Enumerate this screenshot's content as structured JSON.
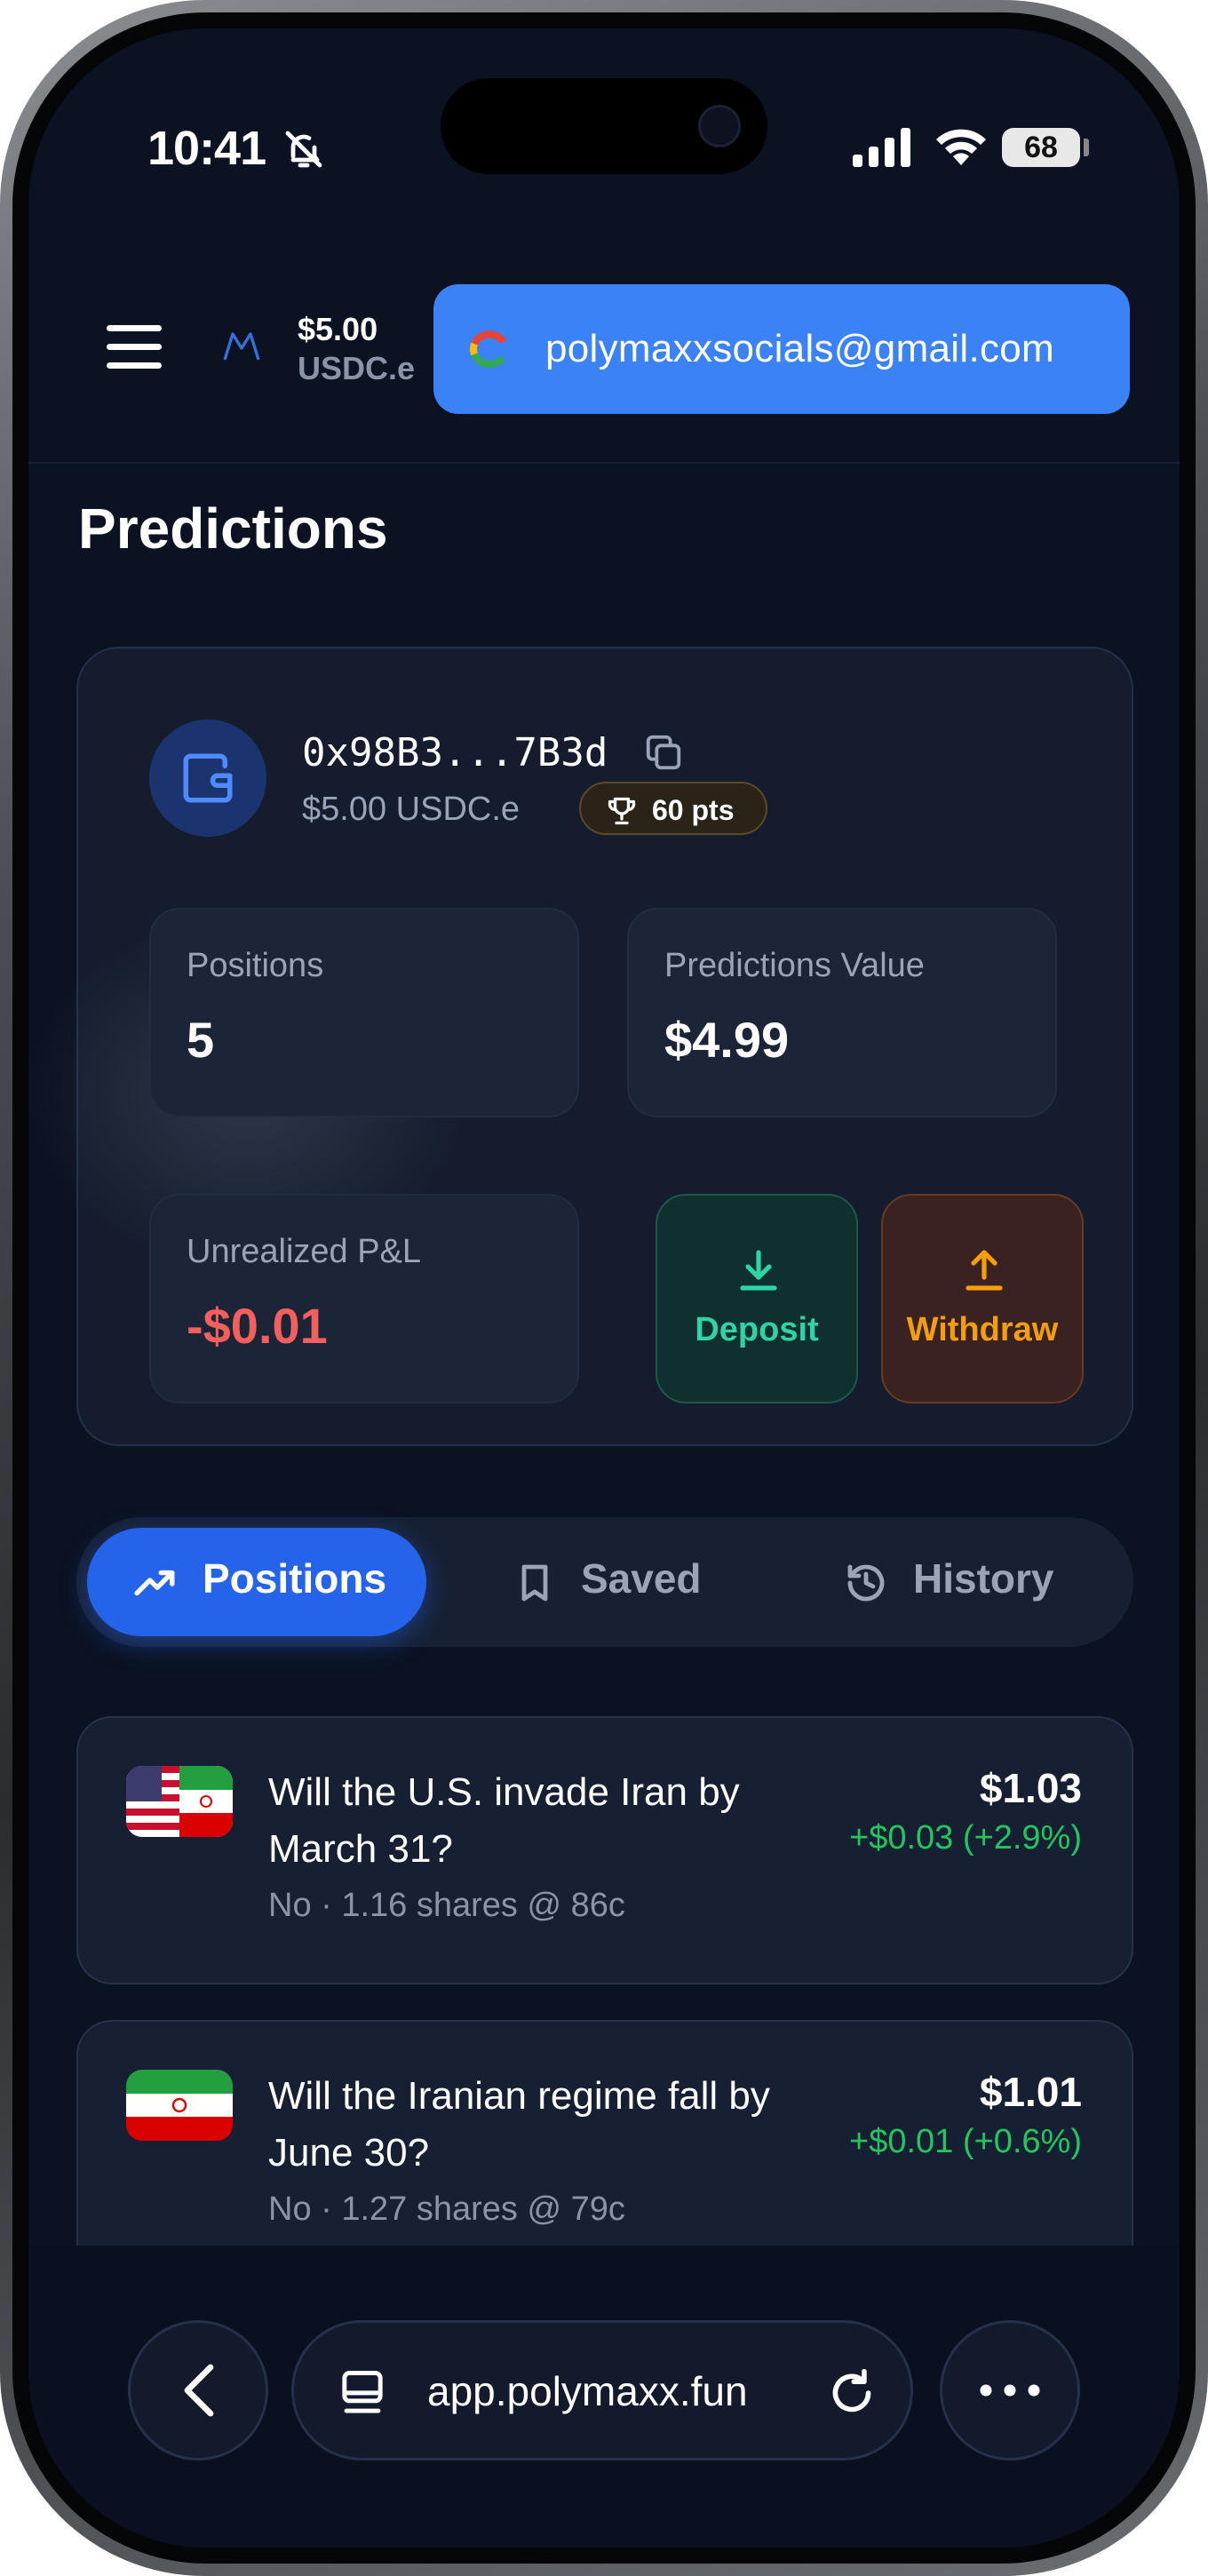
{
  "status_bar": {
    "time": "10:41",
    "battery": "68"
  },
  "header": {
    "balance_amount": "$5.00",
    "balance_unit": "USDC.e",
    "account_email": "polymaxxsocials@gmail.com"
  },
  "page": {
    "title": "Predictions"
  },
  "wallet": {
    "address": "0x98B3...7B3d",
    "balance": "$5.00 USDC.e",
    "points": "60 pts",
    "stats": {
      "positions_label": "Positions",
      "positions_value": "5",
      "value_label": "Predictions Value",
      "value_value": "$4.99",
      "pnl_label": "Unrealized P&L",
      "pnl_value": "-$0.01"
    },
    "deposit_label": "Deposit",
    "withdraw_label": "Withdraw"
  },
  "tabs": [
    {
      "label": "Positions",
      "active": true
    },
    {
      "label": "Saved",
      "active": false
    },
    {
      "label": "History",
      "active": false
    }
  ],
  "positions": [
    {
      "title": "Will the U.S. invade Iran by March 31?",
      "meta": "No · 1.16 shares @ 86c",
      "value": "$1.03",
      "change": "+$0.03 (+2.9%)"
    },
    {
      "title": "Will the Iranian regime fall by June 30?",
      "meta": "No · 1.27 shares @ 79c",
      "value": "$1.01",
      "change": "+$0.01 (+0.6%)"
    }
  ],
  "browser": {
    "url": "app.polymaxx.fun"
  },
  "colors": {
    "accent": "#2563eb",
    "positive": "#22c55e",
    "negative": "#f25f5c",
    "deposit": "#2dd4a4",
    "withdraw": "#f59e0b"
  }
}
